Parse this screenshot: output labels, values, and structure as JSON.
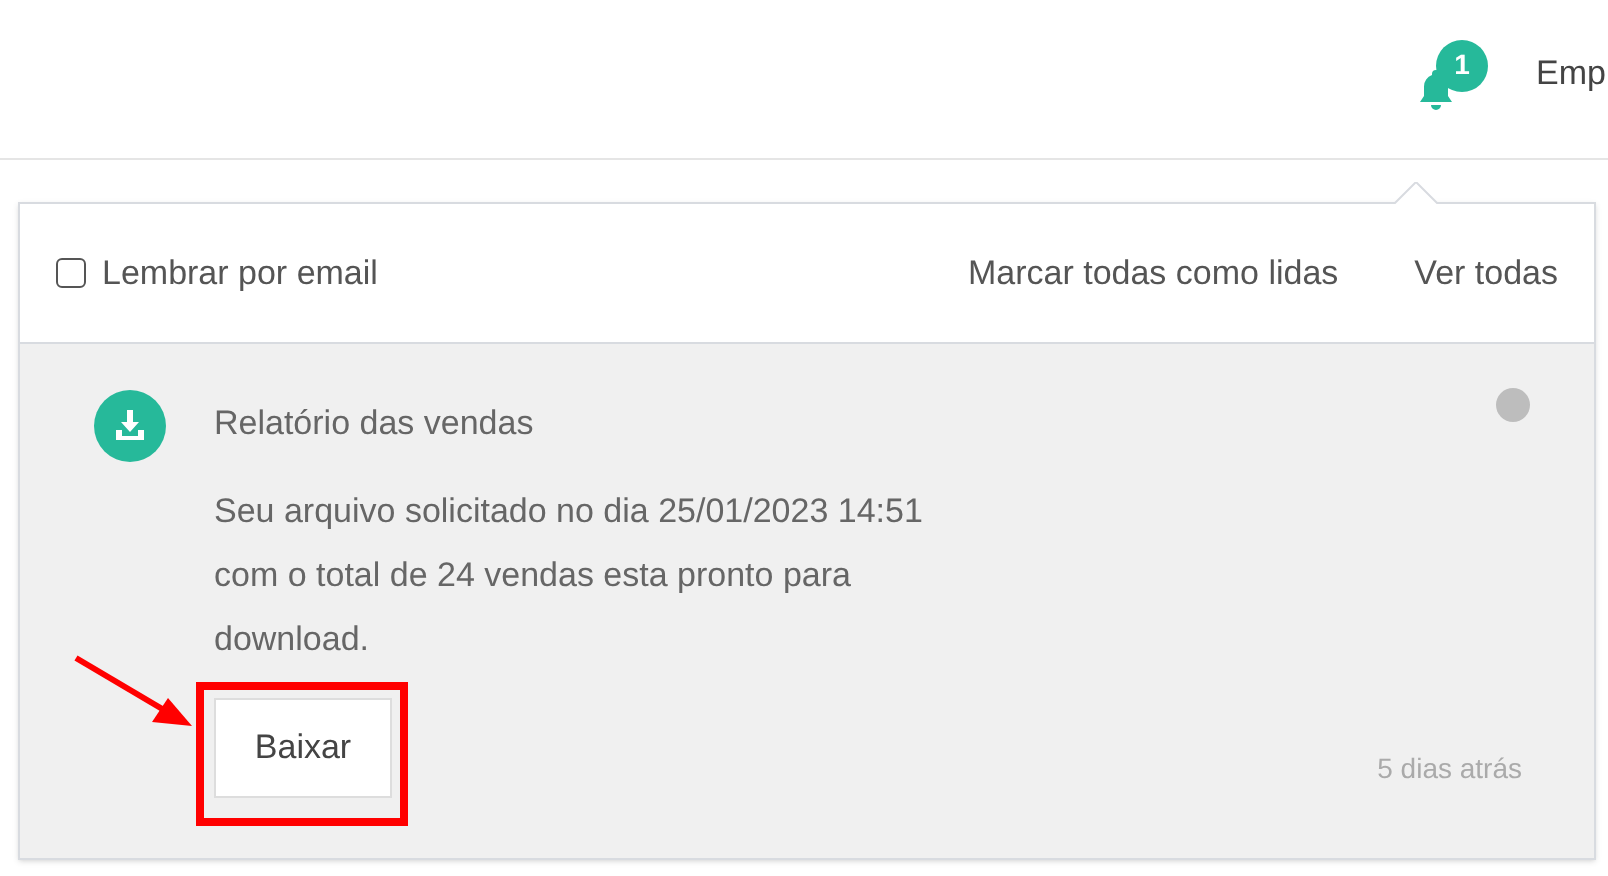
{
  "topbar": {
    "notification_count": "1",
    "user_label": "Emp"
  },
  "notifications_panel": {
    "remind_by_email": {
      "label": "Lembrar por email",
      "checked": false
    },
    "actions": [
      "Marcar todas como lidas",
      "Ver todas"
    ],
    "items": [
      {
        "title": "Relatório das vendas",
        "unread": true,
        "body": [
          "Seu arquivo solicitado no dia 25/01/2023 14:51",
          "com o total de 24 vendas esta pronto para",
          "download."
        ],
        "button": "Baixar",
        "highlighted": true,
        "time": "5 dias atrás"
      }
    ]
  }
}
